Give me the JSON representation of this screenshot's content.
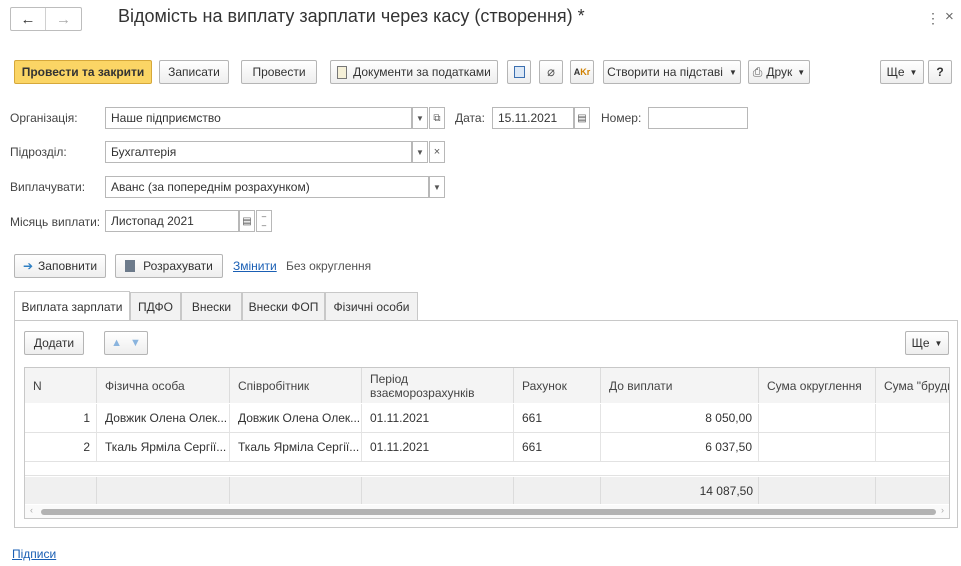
{
  "window": {
    "title": "Відомість на виплату зарплати через касу (створення) *",
    "back_icon": "←",
    "forward_icon": "→",
    "more_icon": "⋮",
    "close_icon": "×"
  },
  "toolbar": {
    "post_close": "Провести та закрити",
    "save": "Записати",
    "post": "Провести",
    "tax_docs": "Документи за податками",
    "create_based": "Створити на підставі",
    "print": "Друк",
    "more": "Ще",
    "help": "?"
  },
  "form": {
    "org_label": "Організація:",
    "org_value": "Наше підприємство",
    "date_label": "Дата:",
    "date_value": "15.11.2021",
    "number_label": "Номер:",
    "number_value": "",
    "dept_label": "Підрозділ:",
    "dept_value": "Бухгалтерія",
    "pay_label": "Виплачувати:",
    "pay_value": "Аванс (за попереднім розрахунком)",
    "month_label": "Місяць виплати:",
    "month_value": "Листопад 2021"
  },
  "actions": {
    "fill": "Заповнити",
    "calculate": "Розрахувати",
    "change_link": "Змінити",
    "rounding": "Без округлення"
  },
  "tabs": [
    {
      "label": "Виплата зарплати"
    },
    {
      "label": "ПДФО"
    },
    {
      "label": "Внески"
    },
    {
      "label": "Внески ФОП"
    },
    {
      "label": "Фізичні особи"
    }
  ],
  "table_toolbar": {
    "add": "Додати",
    "more": "Ще"
  },
  "table": {
    "columns": [
      "N",
      "Фізична особа",
      "Співробітник",
      "Період взаєморозрахунків",
      "Рахунок",
      "До виплати",
      "Сума округлення",
      "Сума \"брудн"
    ],
    "rows": [
      {
        "n": "1",
        "person": "Довжик Олена Олек...",
        "employee": "Довжик Олена Олек...",
        "period": "01.11.2021",
        "account": "661",
        "amount": "8 050,00",
        "rounding": "",
        "gross": ""
      },
      {
        "n": "2",
        "person": "Ткаль Ярміла Сергії...",
        "employee": "Ткаль Ярміла Сергії...",
        "period": "01.11.2021",
        "account": "661",
        "amount": "6 037,50",
        "rounding": "",
        "gross": ""
      }
    ],
    "total": "14 087,50"
  },
  "footer": {
    "signatures": "Підписи"
  },
  "colors": {
    "accent": "#fbd565",
    "link": "#1a5fb4"
  }
}
